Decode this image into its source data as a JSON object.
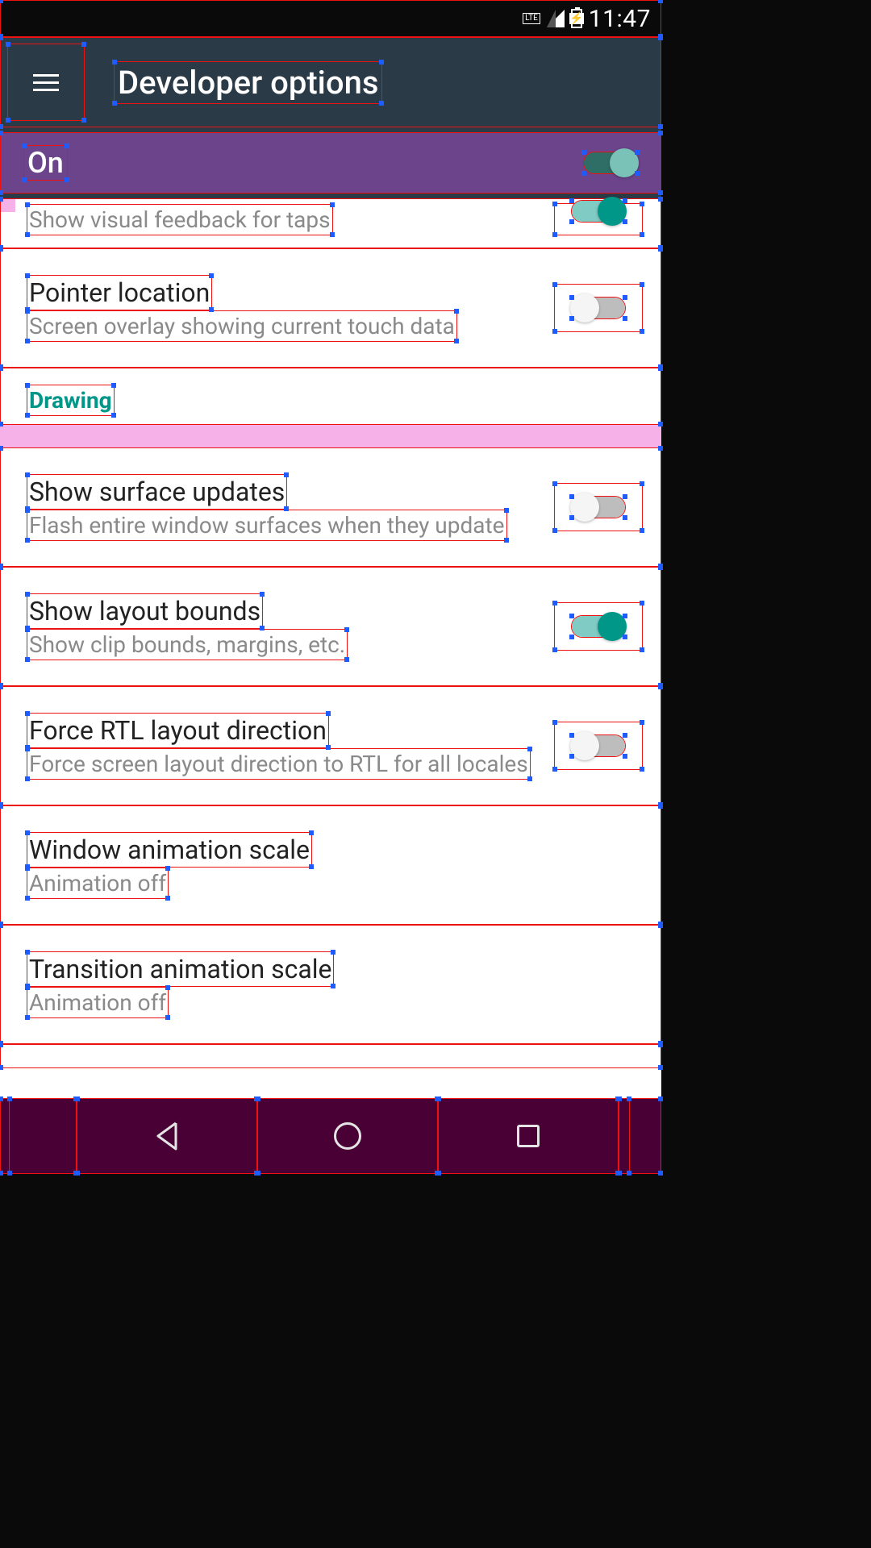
{
  "statusbar": {
    "time": "11:47",
    "network_label": "LTE"
  },
  "appbar": {
    "title": "Developer options",
    "menu_icon": "hamburger-icon"
  },
  "master": {
    "label": "On",
    "state": "on"
  },
  "section_headers": {
    "drawing": "Drawing"
  },
  "rows": [
    {
      "id": "show-taps",
      "title": "",
      "subtitle": "Show visual feedback for taps",
      "has_switch": true,
      "switch_state": "on"
    },
    {
      "id": "pointer-location",
      "title": "Pointer location",
      "subtitle": "Screen overlay showing current touch data",
      "has_switch": true,
      "switch_state": "off"
    },
    {
      "id": "show-surface-updates",
      "title": "Show surface updates",
      "subtitle": "Flash entire window surfaces when they update",
      "has_switch": true,
      "switch_state": "off"
    },
    {
      "id": "show-layout-bounds",
      "title": "Show layout bounds",
      "subtitle": "Show clip bounds, margins, etc.",
      "has_switch": true,
      "switch_state": "on"
    },
    {
      "id": "force-rtl",
      "title": "Force RTL layout direction",
      "subtitle": "Force screen layout direction to RTL for all locales",
      "has_switch": true,
      "switch_state": "off"
    },
    {
      "id": "window-anim-scale",
      "title": "Window animation scale",
      "subtitle": "Animation off",
      "has_switch": false
    },
    {
      "id": "transition-anim-scale",
      "title": "Transition animation scale",
      "subtitle": "Animation off",
      "has_switch": false
    }
  ],
  "colors": {
    "appbar_bg": "#2a3a47",
    "master_bg": "#6b448b",
    "accent": "#009688",
    "navbar_bg": "#490034",
    "debug_red": "#ee1111",
    "debug_blue": "#1e5cff",
    "margin_pink": "#f7b1e9"
  }
}
